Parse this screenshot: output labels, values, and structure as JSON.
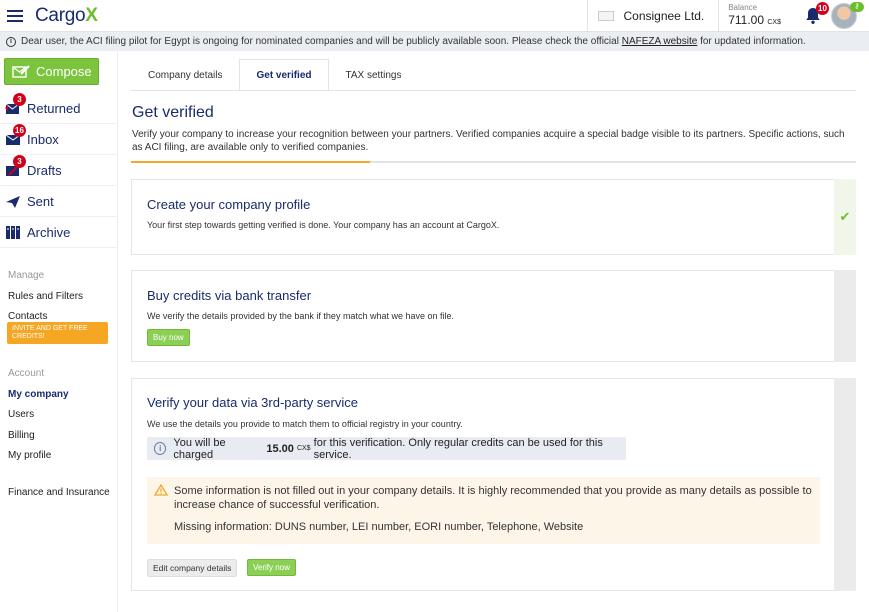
{
  "app": {
    "logo_main": "Cargo",
    "logo_accent": "X"
  },
  "header": {
    "company_name": "Consignee Ltd.",
    "balance_label": "Balance",
    "balance_value": "711.00",
    "balance_unit": "CX$",
    "notifications_count": "10"
  },
  "notice": {
    "text_before": "Dear user, the ACI filing pilot for Egypt is ongoing for nominated companies and will be publicly available soon. Please check the official ",
    "link": "NAFEZA website",
    "text_after": " for updated information."
  },
  "sidebar": {
    "compose_label": "Compose",
    "items": [
      {
        "label": "Returned",
        "badge": "3"
      },
      {
        "label": "Inbox",
        "badge": "16"
      },
      {
        "label": "Drafts",
        "badge": "3"
      },
      {
        "label": "Sent",
        "badge": ""
      },
      {
        "label": "Archive",
        "badge": ""
      }
    ],
    "manage_title": "Manage",
    "rules": "Rules and Filters",
    "contacts": "Contacts",
    "invite": "INVITE AND GET FREE CREDITS!",
    "account_title": "Account",
    "my_company": "My company",
    "users": "Users",
    "billing": "Billing",
    "my_profile": "My profile",
    "finance": "Finance and Insurance"
  },
  "tabs": [
    {
      "label": "Company details"
    },
    {
      "label": "Get verified",
      "active": true
    },
    {
      "label": "TAX settings"
    }
  ],
  "main": {
    "title": "Get verified",
    "subtitle": "Verify your company to increase your recognition between your partners. Verified companies acquire a special badge visible to its partners. Specific actions, such as ACI filing, are available only to verified companies.",
    "progress_fraction": 0.33
  },
  "cards": {
    "profile": {
      "title": "Create your company profile",
      "text": "Your first step towards getting verified is done. Your company has an account at CargoX."
    },
    "bank": {
      "title": "Buy credits via bank transfer",
      "text": "We verify the details provided by the bank if they match what we have on file.",
      "button": "Buy now"
    },
    "third_party": {
      "title": "Verify your data via 3rd-party service",
      "text": "We use the details you provide to match them to official registry in your country.",
      "charge_before": "You will be charged ",
      "charge_amount": "15.00",
      "charge_unit": "CX$",
      "charge_after": " for this verification. Only regular credits can be used for this service.",
      "warning": "Some information is not filled out in your company details. It is highly recommended that you provide as many details as possible to increase chance of successful verification.",
      "missing": "Missing information: DUNS number, LEI number, EORI number, Telephone, Website",
      "edit_button": "Edit company details",
      "verify_button": "Verify now"
    }
  },
  "colors": {
    "brand": "#1a2b6d",
    "accent": "#6bbf2c",
    "warning": "#f5a623",
    "badge": "#d0021b"
  }
}
